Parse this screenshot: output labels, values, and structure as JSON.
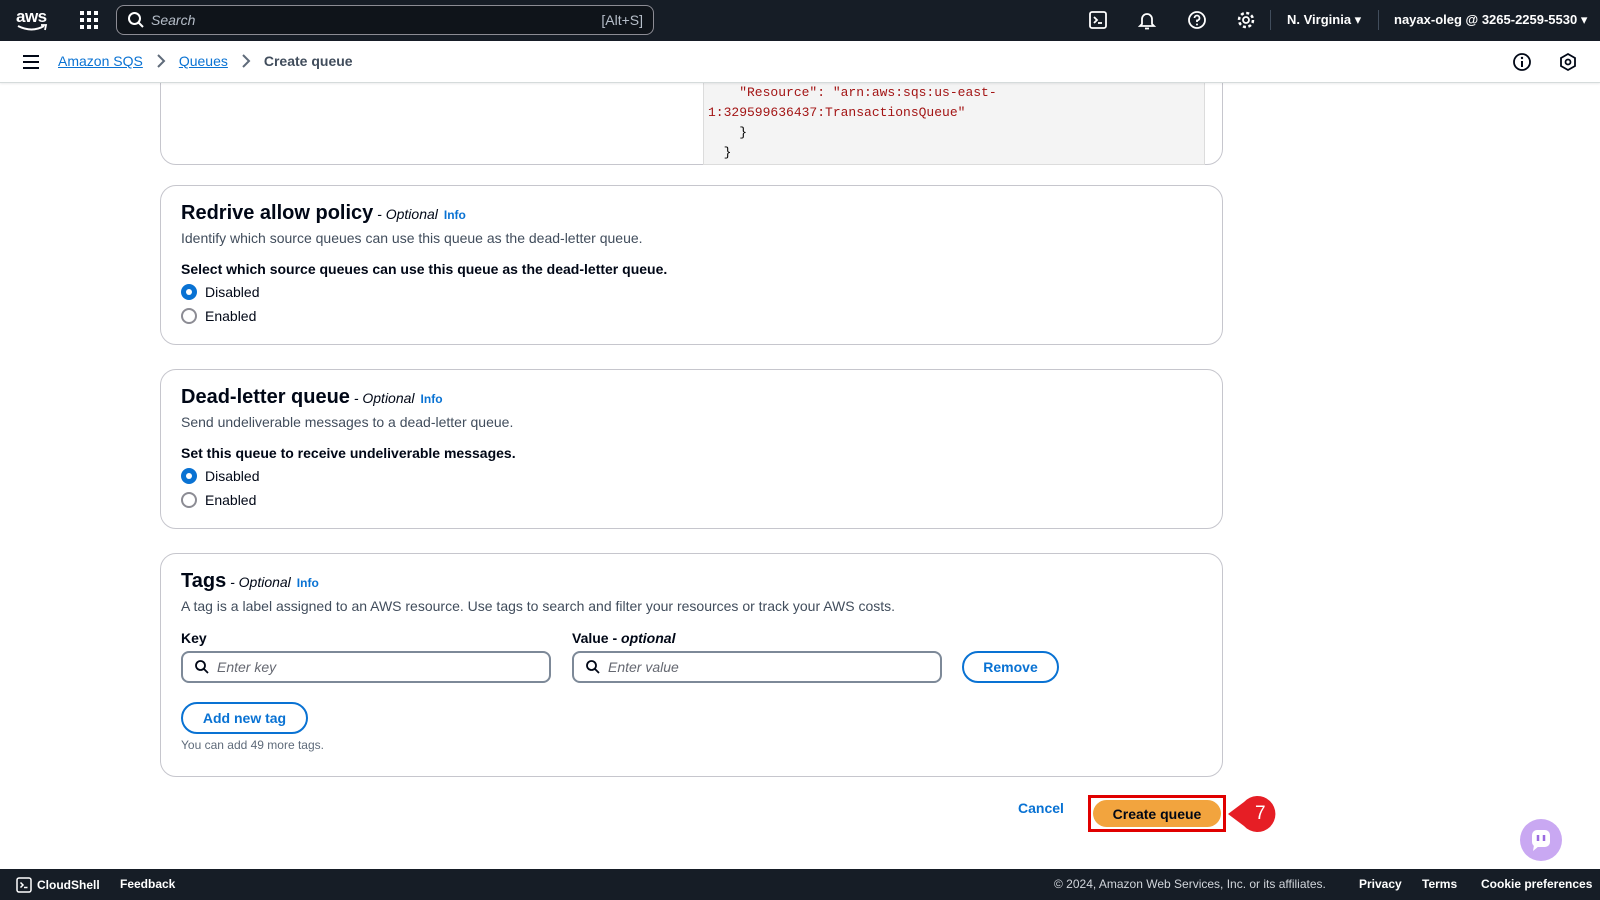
{
  "topnav": {
    "logo_text": "aws",
    "search_placeholder": "Search",
    "search_shortcut": "[Alt+S]",
    "region": "N. Virginia ▾",
    "account": "nayax-oleg @ 3265-2259-5530 ▾"
  },
  "breadcrumb": {
    "items": [
      "Amazon SQS",
      "Queues"
    ],
    "current": "Create queue"
  },
  "access_policy_code": {
    "lines": [
      "    \"Resource\": \"arn:aws:sqs:us-east-",
      "1:329599636437:TransactionsQueue\"",
      "    }",
      "  }"
    ]
  },
  "redrive": {
    "title": "Redrive allow policy",
    "optional": " - Optional",
    "info": "Info",
    "description": "Identify which source queues can use this queue as the dead-letter queue.",
    "question": "Select which source queues can use this queue as the dead-letter queue.",
    "options": [
      {
        "label": "Disabled",
        "selected": true
      },
      {
        "label": "Enabled",
        "selected": false
      }
    ]
  },
  "dlq": {
    "title": "Dead-letter queue",
    "optional": " - Optional",
    "info": "Info",
    "description": "Send undeliverable messages to a dead-letter queue.",
    "question": "Set this queue to receive undeliverable messages.",
    "options": [
      {
        "label": "Disabled",
        "selected": true
      },
      {
        "label": "Enabled",
        "selected": false
      }
    ]
  },
  "tags": {
    "title": "Tags",
    "optional": " - Optional",
    "info": "Info",
    "description": "A tag is a label assigned to an AWS resource. Use tags to search and filter your resources or track your AWS costs.",
    "key_label": "Key",
    "value_label": "Value - ",
    "value_optional": "optional",
    "key_placeholder": "Enter key",
    "value_placeholder": "Enter value",
    "remove_label": "Remove",
    "add_label": "Add new tag",
    "hint": "You can add 49 more tags."
  },
  "actions": {
    "cancel": "Cancel",
    "create": "Create queue",
    "step_number": "7"
  },
  "footer": {
    "cloudshell": "CloudShell",
    "feedback": "Feedback",
    "copyright": "© 2024, Amazon Web Services, Inc. or its affiliates.",
    "privacy": "Privacy",
    "terms": "Terms",
    "cookies": "Cookie preferences"
  },
  "colors": {
    "nav_bg": "#161d26",
    "link": "#0972d3",
    "primary_button": "#f2a43e",
    "highlight": "#e00000"
  }
}
